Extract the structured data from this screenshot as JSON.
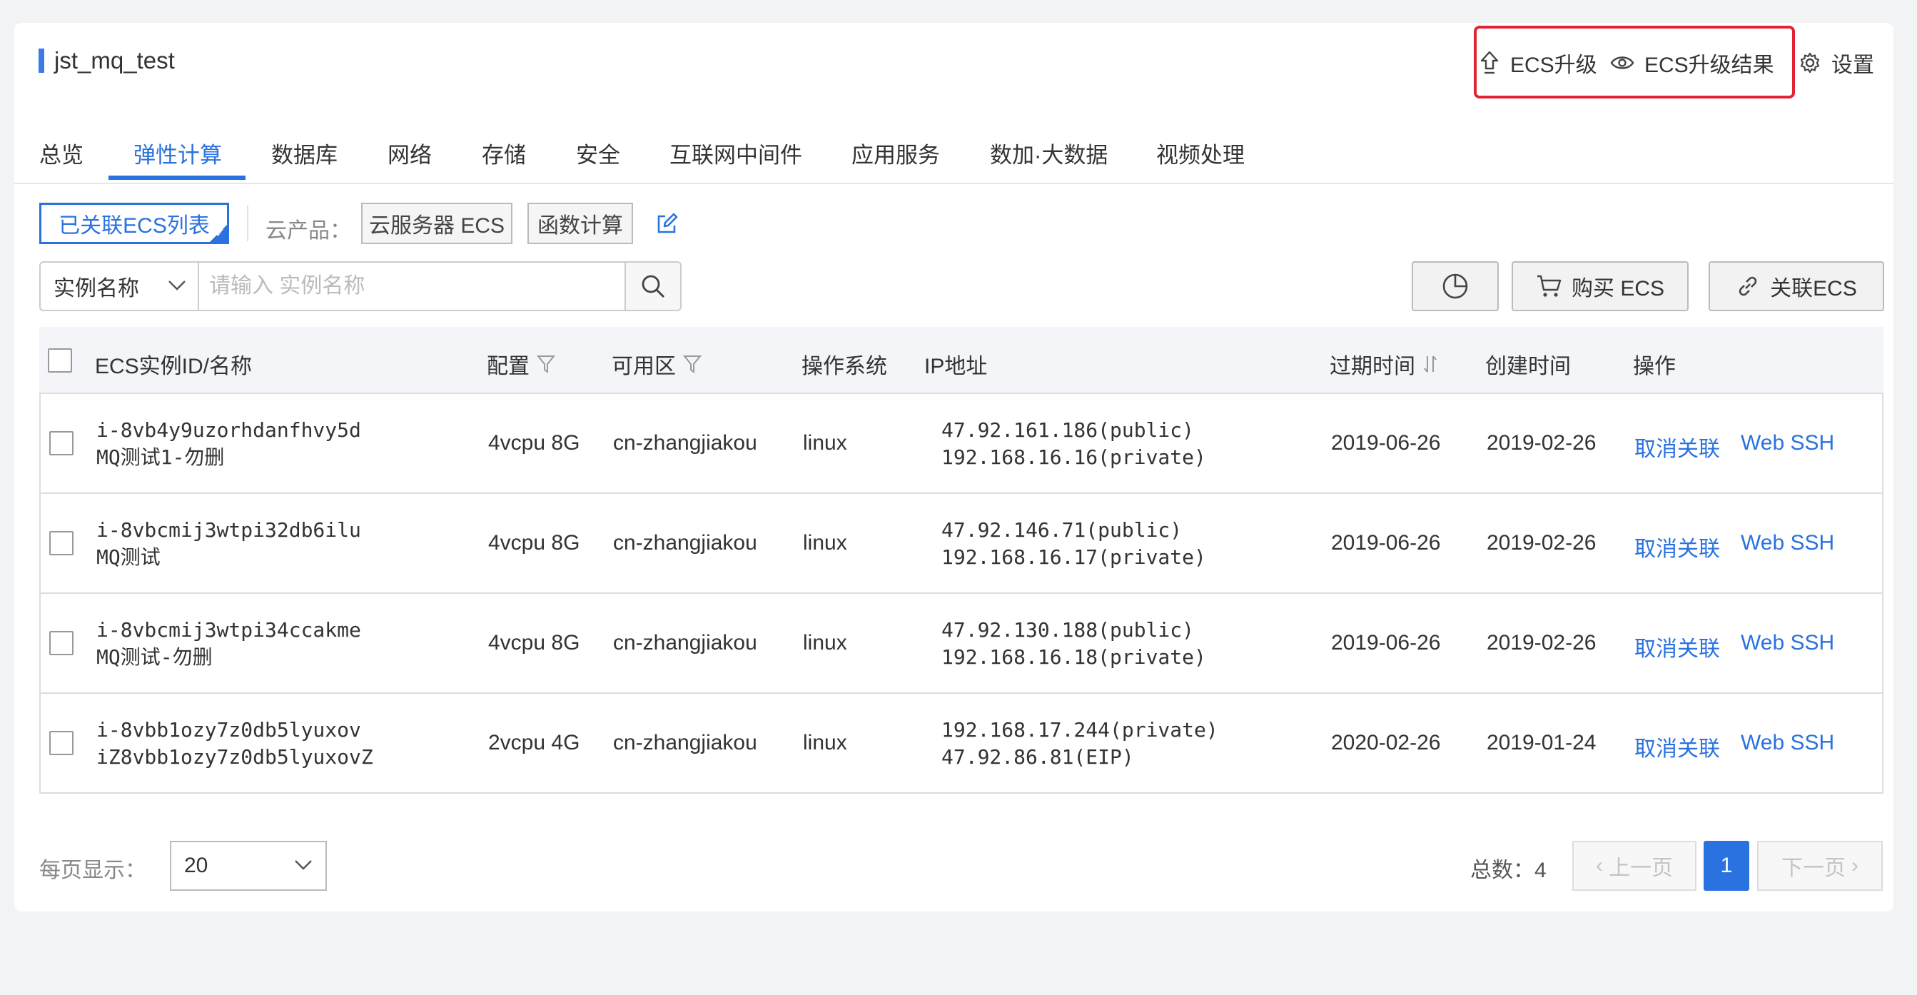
{
  "header": {
    "title": "jst_mq_test",
    "actions": [
      {
        "label": "ECS升级",
        "icon": "upgrade-icon"
      },
      {
        "label": "ECS升级结果",
        "icon": "eye-icon"
      },
      {
        "label": "设置",
        "icon": "gear-icon"
      }
    ]
  },
  "tabs": [
    "总览",
    "弹性计算",
    "数据库",
    "网络",
    "存储",
    "安全",
    "互联网中间件",
    "应用服务",
    "数加·大数据",
    "视频处理"
  ],
  "active_tab": "弹性计算",
  "filter": {
    "active_chip": "已关联ECS列表",
    "label": "云产品：",
    "chips": [
      "云服务器 ECS",
      "函数计算"
    ]
  },
  "search": {
    "select_value": "实例名称",
    "placeholder": "请输入 实例名称"
  },
  "buttons": {
    "buy": "购买 ECS",
    "link": "关联ECS"
  },
  "table": {
    "headers": {
      "id": "ECS实例ID/名称",
      "config": "配置",
      "zone": "可用区",
      "os": "操作系统",
      "ip": "IP地址",
      "expire": "过期时间",
      "created": "创建时间",
      "actions": "操作"
    },
    "rows": [
      {
        "id": "i-8vb4y9uzorhdanfhvy5d",
        "name": "MQ测试1-勿删",
        "config": "4vcpu 8G",
        "zone": "cn-zhangjiakou",
        "os": "linux",
        "ip1": "47.92.161.186(public)",
        "ip2": "192.168.16.16(private)",
        "expire": "2019-06-26",
        "created": "2019-02-26",
        "unlink": "取消关联",
        "ssh": "Web SSH"
      },
      {
        "id": "i-8vbcmij3wtpi32db6ilu",
        "name": "MQ测试",
        "config": "4vcpu 8G",
        "zone": "cn-zhangjiakou",
        "os": "linux",
        "ip1": "47.92.146.71(public)",
        "ip2": "192.168.16.17(private)",
        "expire": "2019-06-26",
        "created": "2019-02-26",
        "unlink": "取消关联",
        "ssh": "Web SSH"
      },
      {
        "id": "i-8vbcmij3wtpi34ccakme",
        "name": "MQ测试-勿删",
        "config": "4vcpu 8G",
        "zone": "cn-zhangjiakou",
        "os": "linux",
        "ip1": "47.92.130.188(public)",
        "ip2": "192.168.16.18(private)",
        "expire": "2019-06-26",
        "created": "2019-02-26",
        "unlink": "取消关联",
        "ssh": "Web SSH"
      },
      {
        "id": "i-8vbb1ozy7z0db5lyuxov",
        "name": "iZ8vbb1ozy7z0db5lyuxovZ",
        "config": "2vcpu 4G",
        "zone": "cn-zhangjiakou",
        "os": "linux",
        "ip1": "192.168.17.244(private)",
        "ip2": "47.92.86.81(EIP)",
        "expire": "2020-02-26",
        "created": "2019-01-24",
        "unlink": "取消关联",
        "ssh": "Web SSH"
      }
    ]
  },
  "pagination": {
    "page_size_label": "每页显示：",
    "page_size": "20",
    "total_label": "总数：",
    "total": "4",
    "prev": "上一页",
    "next": "下一页",
    "current": "1"
  },
  "colors": {
    "accent": "#2a72e0",
    "highlight_box": "#e02433"
  }
}
